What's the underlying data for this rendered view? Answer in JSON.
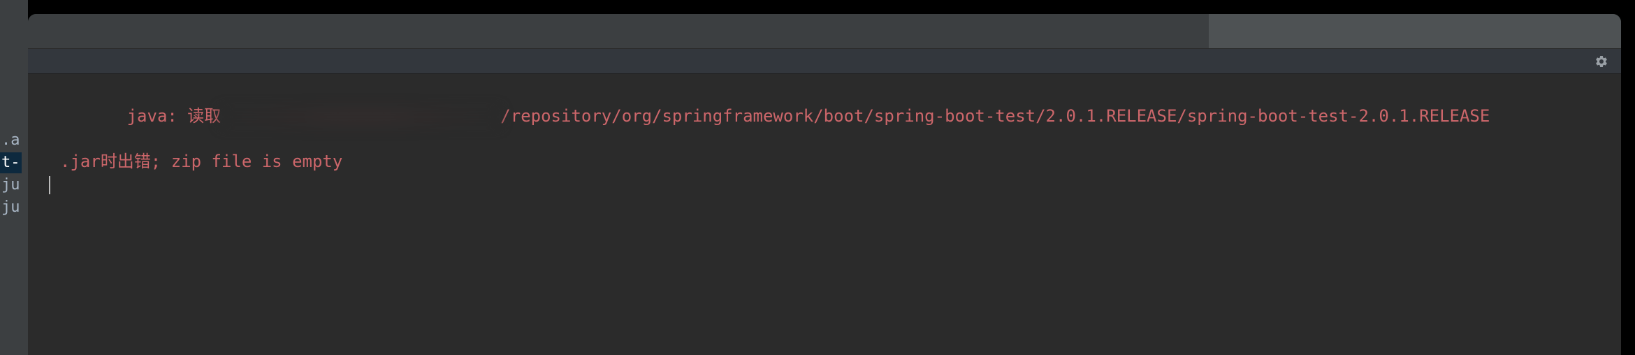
{
  "sidebar": {
    "items": [
      {
        "label": ".a"
      },
      {
        "label": "t-",
        "highlighted": true
      },
      {
        "label": "ju"
      },
      {
        "label": "ju"
      }
    ]
  },
  "console": {
    "error_prefix": "java: 读取",
    "error_path": "/repository/org/springframework/boot/spring-boot-test/2.0.1.RELEASE/spring-boot-test-2.0.1.RELEASE",
    "error_line2": ".jar时出错; zip file is empty"
  },
  "icons": {
    "gear": "gear-icon"
  }
}
